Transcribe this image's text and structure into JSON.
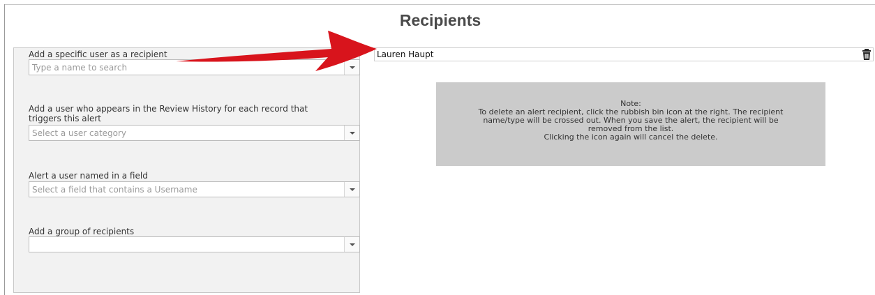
{
  "header": {
    "title": "Recipients"
  },
  "panel": {
    "specific_user": {
      "label": "Add a specific user as a recipient",
      "placeholder": "Type a name to search"
    },
    "review_history": {
      "label_line1": "Add a user who appears in the Review History for each record that",
      "label_line2": "triggers this alert",
      "placeholder": "Select a user category"
    },
    "field_user": {
      "label": "Alert a user named in a field",
      "placeholder": "Select a field that contains a Username"
    },
    "group": {
      "label": "Add a group of recipients",
      "placeholder": ""
    }
  },
  "recipients": [
    {
      "name": "Lauren Haupt",
      "icon": "trash-icon"
    }
  ],
  "note": {
    "heading": "Note:",
    "line1": "To delete an alert recipient, click the rubbish bin icon at the right. The recipient",
    "line2": "name/type will be crossed out. When you save the alert, the recipient will be",
    "line3": "removed from the list.",
    "line4": "Clicking the icon again will cancel the delete."
  },
  "colors": {
    "arrow": "#d8141c",
    "note_bg": "#cbcbcb",
    "panel_bg": "#f2f2f2"
  }
}
